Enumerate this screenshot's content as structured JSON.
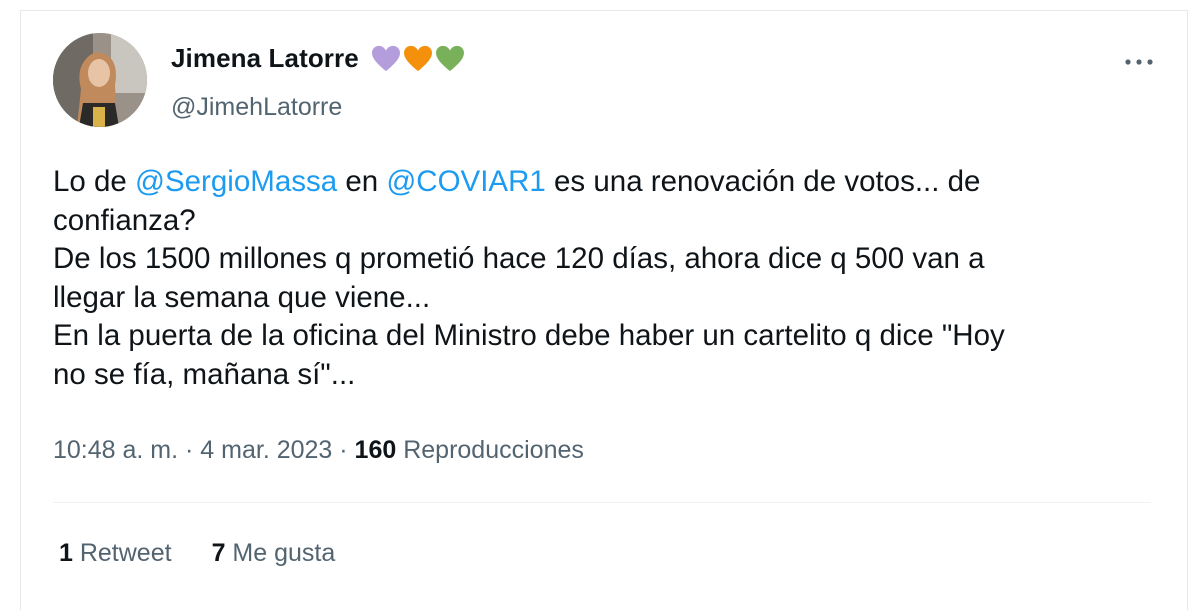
{
  "tweet": {
    "author": {
      "display_name": "Jimena Latorre",
      "handle": "@JimehLatorre",
      "emoji": [
        {
          "name": "purple-heart",
          "color": "#b39ddb"
        },
        {
          "name": "orange-heart",
          "color": "#f4900c"
        },
        {
          "name": "green-heart",
          "color": "#78b159"
        }
      ]
    },
    "body": {
      "line1": {
        "t1": "Lo de ",
        "mention1": "@SergioMassa",
        "t2": " en ",
        "mention2": "@COVIAR1",
        "t3": " es una renovación de votos... de"
      },
      "line2": "confianza?",
      "line3": "De los 1500 millones q prometió hace 120 días, ahora dice q 500 van a",
      "line4": "llegar la semana que viene...",
      "line5": "En la puerta de la oficina del Ministro debe haber un cartelito q dice \"Hoy",
      "line6": "no se fía,  mañana sí\"..."
    },
    "meta": {
      "time": "10:48 a. m.",
      "sep1": " · ",
      "date": "4 mar. 2023",
      "sep2": " · ",
      "views_count": "160",
      "views_label": " Reproducciones"
    },
    "stats": {
      "retweets_count": "1",
      "retweets_label": " Retweet",
      "likes_count": "7",
      "likes_label": " Me gusta"
    },
    "more_icon": "more-horizontal-icon",
    "colors": {
      "text": "#0f1419",
      "secondary": "#536471",
      "mention": "#1d9bf0",
      "border": "#e6e8ea"
    }
  }
}
